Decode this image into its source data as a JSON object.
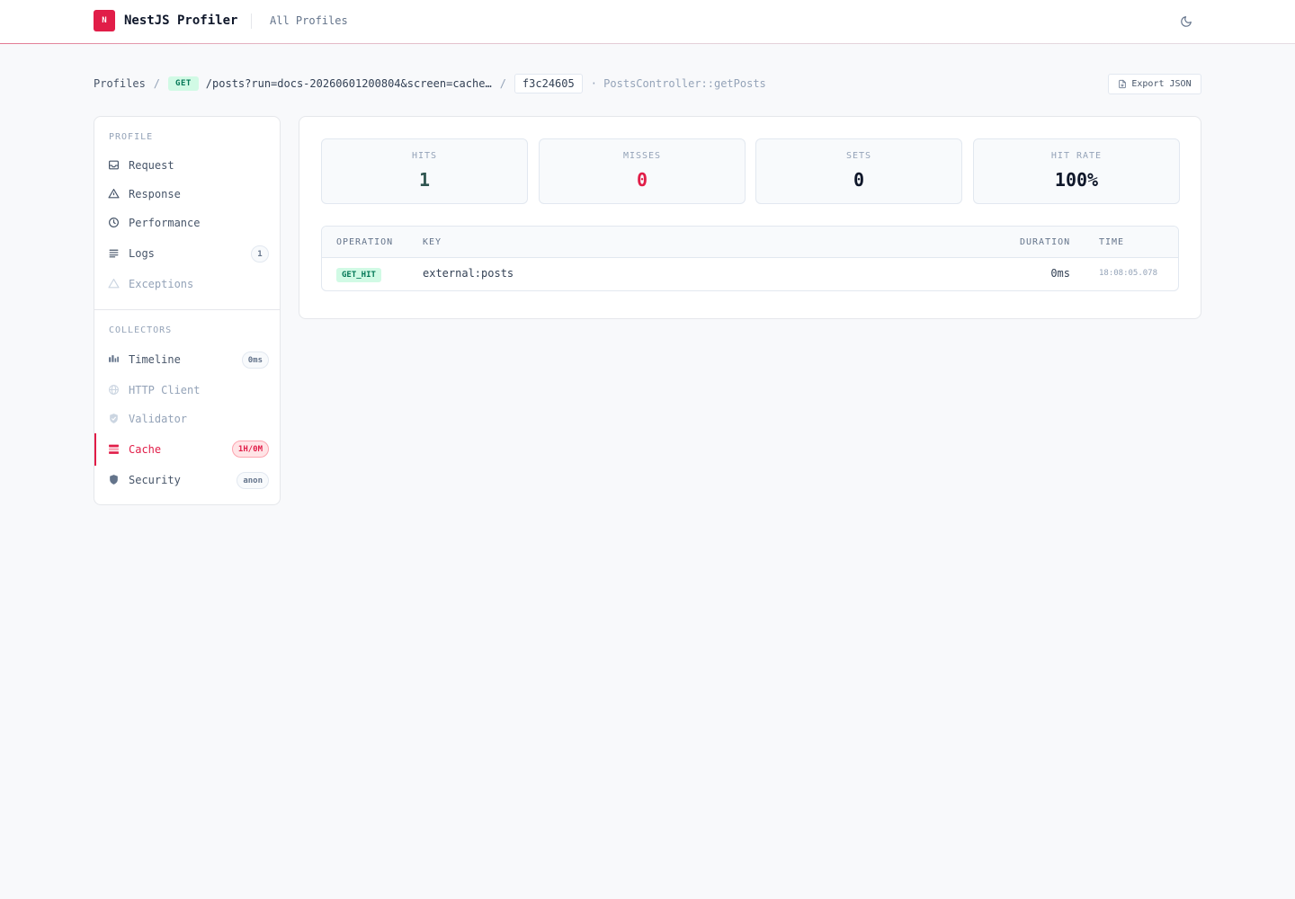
{
  "app": {
    "logo_letter": "N",
    "title": "NestJS Profiler",
    "nav_all_profiles": "All Profiles",
    "accent": "#e11d48"
  },
  "breadcrumb": {
    "root": "Profiles",
    "separator": "/",
    "method": "GET",
    "path": "/posts?run=docs-20260601200804&screen=cache…",
    "token": "f3c24605",
    "controller": "· PostsController::getPosts"
  },
  "actions": {
    "export": "Export JSON"
  },
  "sidebar": {
    "profile_heading": "PROFILE",
    "profile_items": [
      {
        "label": "Request",
        "icon": "inbox-icon"
      },
      {
        "label": "Response",
        "icon": "triangle-icon"
      },
      {
        "label": "Performance",
        "icon": "clock-icon"
      },
      {
        "label": "Logs",
        "icon": "lines-icon",
        "badge": "1"
      },
      {
        "label": "Exceptions",
        "icon": "warning-icon"
      }
    ],
    "collectors_heading": "COLLECTORS",
    "collector_items": [
      {
        "label": "Timeline",
        "icon": "bars-icon",
        "badge": "0ms"
      },
      {
        "label": "HTTP Client",
        "icon": "globe-icon"
      },
      {
        "label": "Validator",
        "icon": "shield-check-icon"
      },
      {
        "label": "Cache",
        "icon": "database-icon",
        "badge": "1H/0M"
      },
      {
        "label": "Security",
        "icon": "shield-icon",
        "badge": "anon"
      }
    ]
  },
  "stats": [
    {
      "label": "HITS",
      "value": "1"
    },
    {
      "label": "MISSES",
      "value": "0"
    },
    {
      "label": "SETS",
      "value": "0"
    },
    {
      "label": "HIT RATE",
      "value": "100%"
    }
  ],
  "table": {
    "columns": [
      "OPERATION",
      "KEY",
      "DURATION",
      "TIME"
    ],
    "rows": [
      {
        "operation": "GET_HIT",
        "key": "external:posts",
        "duration": "0ms",
        "time": "18:08:05.078"
      }
    ]
  }
}
